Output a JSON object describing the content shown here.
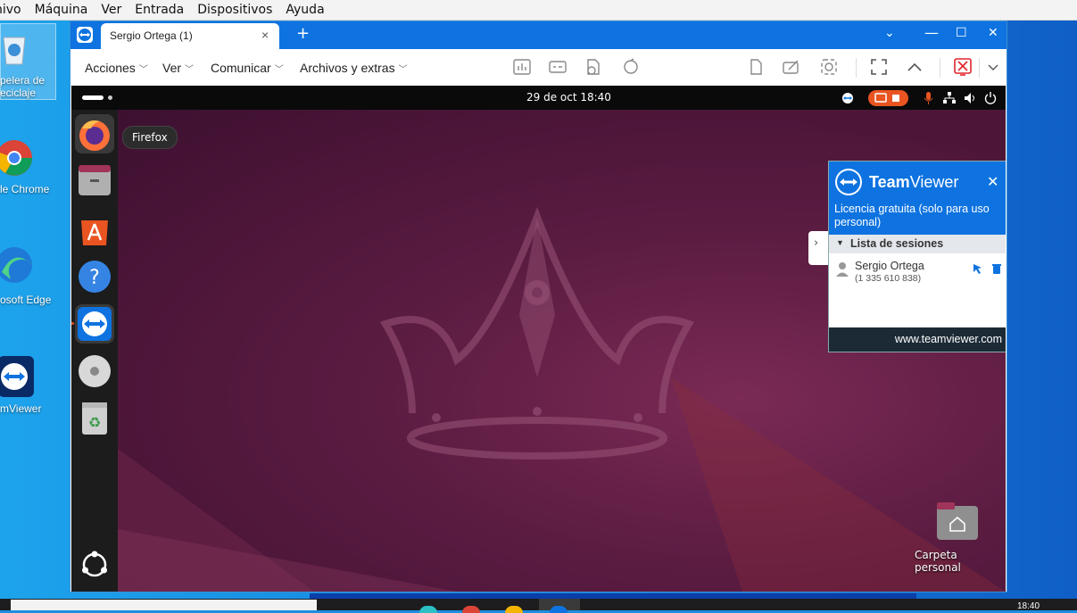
{
  "vbox_menu": [
    "hivo",
    "Máquina",
    "Ver",
    "Entrada",
    "Dispositivos",
    "Ayuda"
  ],
  "desktop_icons": {
    "recycle": {
      "line1": "pelera de",
      "line2": "eciclaje"
    },
    "chrome": "le Chrome",
    "edge": "osoft Edge",
    "teamviewer": "mViewer"
  },
  "taskbar": {
    "clock": "18:40"
  },
  "tv_window": {
    "tab_title": "Sergio Ortega (1)",
    "menus": [
      "Acciones",
      "Ver",
      "Comunicar",
      "Archivos y extras"
    ]
  },
  "remote": {
    "topbar_clock": "29 de oct  18:40",
    "tooltip": "Firefox",
    "home_label": "Carpeta personal"
  },
  "tv_popup": {
    "brand_bold": "Team",
    "brand_rest": "Viewer",
    "license": "Licencia gratuita (solo para uso personal)",
    "sessions_header": "Lista de sesiones",
    "session_name": "Sergio Ortega",
    "session_id": "(1 335 610 838)",
    "footer_url": "www.teamviewer.com"
  },
  "colors": {
    "tv_blue": "#0e73e0",
    "ubuntu_orange": "#e95420"
  }
}
